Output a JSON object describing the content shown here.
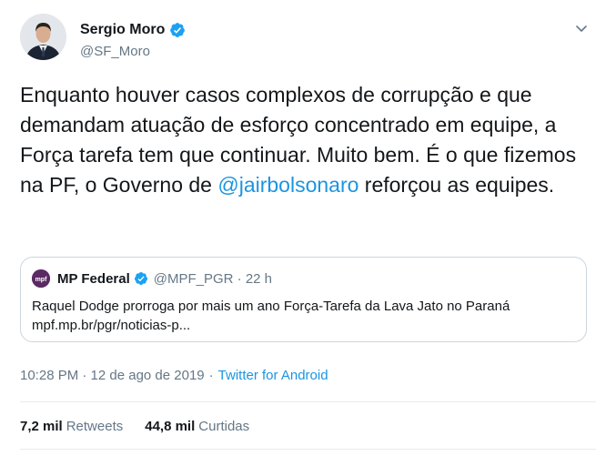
{
  "tweet": {
    "author_name": "Sergio Moro",
    "author_handle": "@SF_Moro",
    "text_part1": "Enquanto houver casos complexos de corrupção e que demandam atuação de esforço concentrado em equipe, a Força tarefa tem que continuar. Muito bem. É o que fizemos na PF, o Governo de ",
    "mention": "@jairbolsonaro",
    "text_part2": " reforçou as equipes.",
    "timestamp": "10:28 PM · 12 de ago de 2019",
    "source_sep": "·",
    "source": "Twitter for Android"
  },
  "quote": {
    "name": "MP Federal",
    "handle": "@MPF_PGR · 22 h",
    "text_line1": "Raquel Dodge prorroga por mais um ano Força-Tarefa da Lava Jato no Paraná",
    "text_line2": "mpf.mp.br/pgr/noticias-p..."
  },
  "stats": {
    "retweets_count": "7,2 mil",
    "retweets_label": "Retweets",
    "likes_count": "44,8 mil",
    "likes_label": "Curtidas"
  },
  "icons": {
    "verified": "verified-badge-icon",
    "caret": "chevron-down-icon",
    "quote_logo": "mpf-logo-icon"
  },
  "colors": {
    "link": "#1b95e0",
    "verified": "#1da1f2",
    "secondary_text": "#657786",
    "border": "#ccd6dd"
  }
}
